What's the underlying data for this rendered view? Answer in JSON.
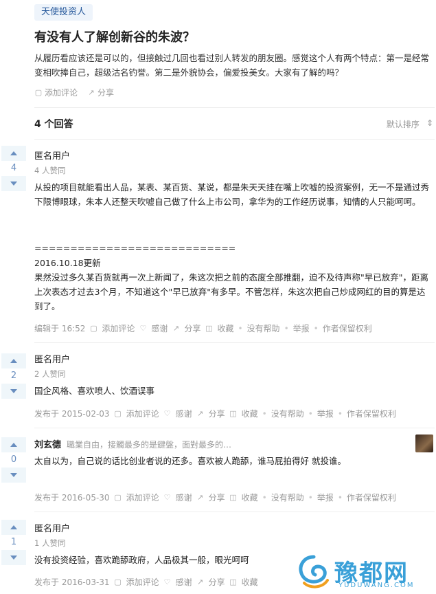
{
  "topic_tag": "天使投资人",
  "question": {
    "title": "有没有人了解创新谷的朱波？",
    "detail": "从履历看应该还是可以的，但接触过几回也看过别人转发的朋友圈。感觉这个人有两个特点：第一是经常变相吹捧自己，超级沽名钓誉。第二是外貌协会，偏爱投美女。大家有了解的吗？",
    "actions": {
      "comment": "添加评论",
      "share": "分享"
    }
  },
  "answers_header": {
    "count_label": "4 个回答",
    "sort_label": "默认排序"
  },
  "answers": [
    {
      "votes": "4",
      "author": "匿名用户",
      "bio": "",
      "votes_text": "4 人赞同",
      "paragraphs": [
        "从投的项目就能看出人品，某表、某百货、某说，都是朱天天挂在嘴上吹嘘的投资案例，无一不是通过秀下限博眼球，朱本人还整天吹嘘自己做了什么上市公司，拿华为的工作经历说事，知情的人只能呵呵。",
        "============================",
        "2016.10.18更新",
        "果然没过多久某百货就再一次上新闻了，朱这次把之前的态度全部推翻，迫不及待声称\"早已放弃\"，距离上次表态才过去3个月，不知道这个\"早已放弃\"有多早。不管怎样，朱这次把自己炒成网红的目的算是达到了。"
      ],
      "meta": {
        "date": "编辑于 16:52",
        "comment": "添加评论",
        "thanks": "感谢",
        "share": "分享",
        "collect": "收藏",
        "unhelpful": "没有帮助",
        "report": "举报",
        "rights": "作者保留权利"
      }
    },
    {
      "votes": "2",
      "author": "匿名用户",
      "bio": "",
      "votes_text": "2 人赞同",
      "paragraphs": [
        "国企风格、喜欢喷人、饮酒误事"
      ],
      "meta": {
        "date": "发布于 2015-02-03",
        "comment": "添加评论",
        "thanks": "感谢",
        "share": "分享",
        "collect": "收藏",
        "unhelpful": "没有帮助",
        "report": "举报",
        "rights": "作者保留权利"
      }
    },
    {
      "votes": "0",
      "author": "刘玄德",
      "bio": "職業自由，接觸最多的是鍵盤，面對最多的…",
      "votes_text": "",
      "paragraphs": [
        "太自以为，自己说的话比创业者说的还多。喜欢被人跪舔，谁马屁拍得好 就投谁。"
      ],
      "meta": {
        "date": "发布于 2016-05-30",
        "comment": "添加评论",
        "thanks": "感谢",
        "share": "分享",
        "collect": "收藏",
        "unhelpful": "没有帮助",
        "report": "举报",
        "rights": "作者保留权利"
      }
    },
    {
      "votes": "1",
      "author": "匿名用户",
      "bio": "",
      "votes_text": "1 人赞同",
      "paragraphs": [
        "没有投资经验，喜欢跪舔政府，人品极其一般，眼光呵呵"
      ],
      "meta": {
        "date": "发布于 2016-03-31",
        "comment": "添加评论",
        "thanks": "感谢",
        "share": "分享",
        "collect": "收藏",
        "unhelpful": "没有帮助",
        "report": "举报",
        "rights": "作者保留权利"
      }
    }
  ],
  "watermark": {
    "text": "豫都网",
    "sub": "YUDUWANG.COM"
  },
  "colors": {
    "link": "#259",
    "vote": "#698ebf",
    "muted": "#999",
    "tag_bg": "#eef4fb"
  }
}
